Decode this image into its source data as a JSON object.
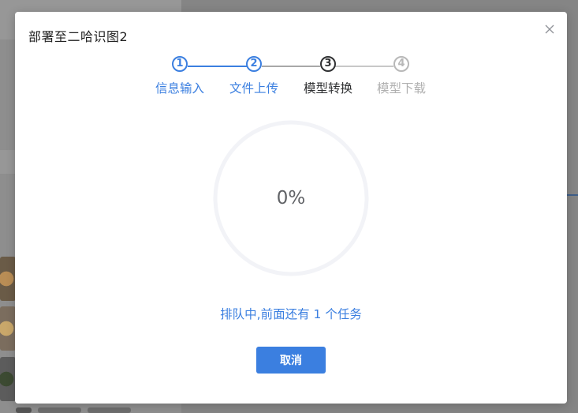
{
  "dialog": {
    "title": "部署至二哈识图2",
    "close_icon": "close-icon"
  },
  "steps": [
    {
      "number": "1",
      "label": "信息输入",
      "status": "done"
    },
    {
      "number": "2",
      "label": "文件上传",
      "status": "done"
    },
    {
      "number": "3",
      "label": "模型转换",
      "status": "active"
    },
    {
      "number": "4",
      "label": "模型下载",
      "status": "wait"
    }
  ],
  "progress": {
    "value": 0,
    "text": "0%"
  },
  "queue": {
    "text": "排队中,前面还有 1 个任务"
  },
  "buttons": {
    "cancel_label": "取消"
  },
  "colors": {
    "primary": "#3b7fe0",
    "active": "#303133",
    "wait": "#b8b8b8",
    "ring_track": "#f2f3f7"
  }
}
